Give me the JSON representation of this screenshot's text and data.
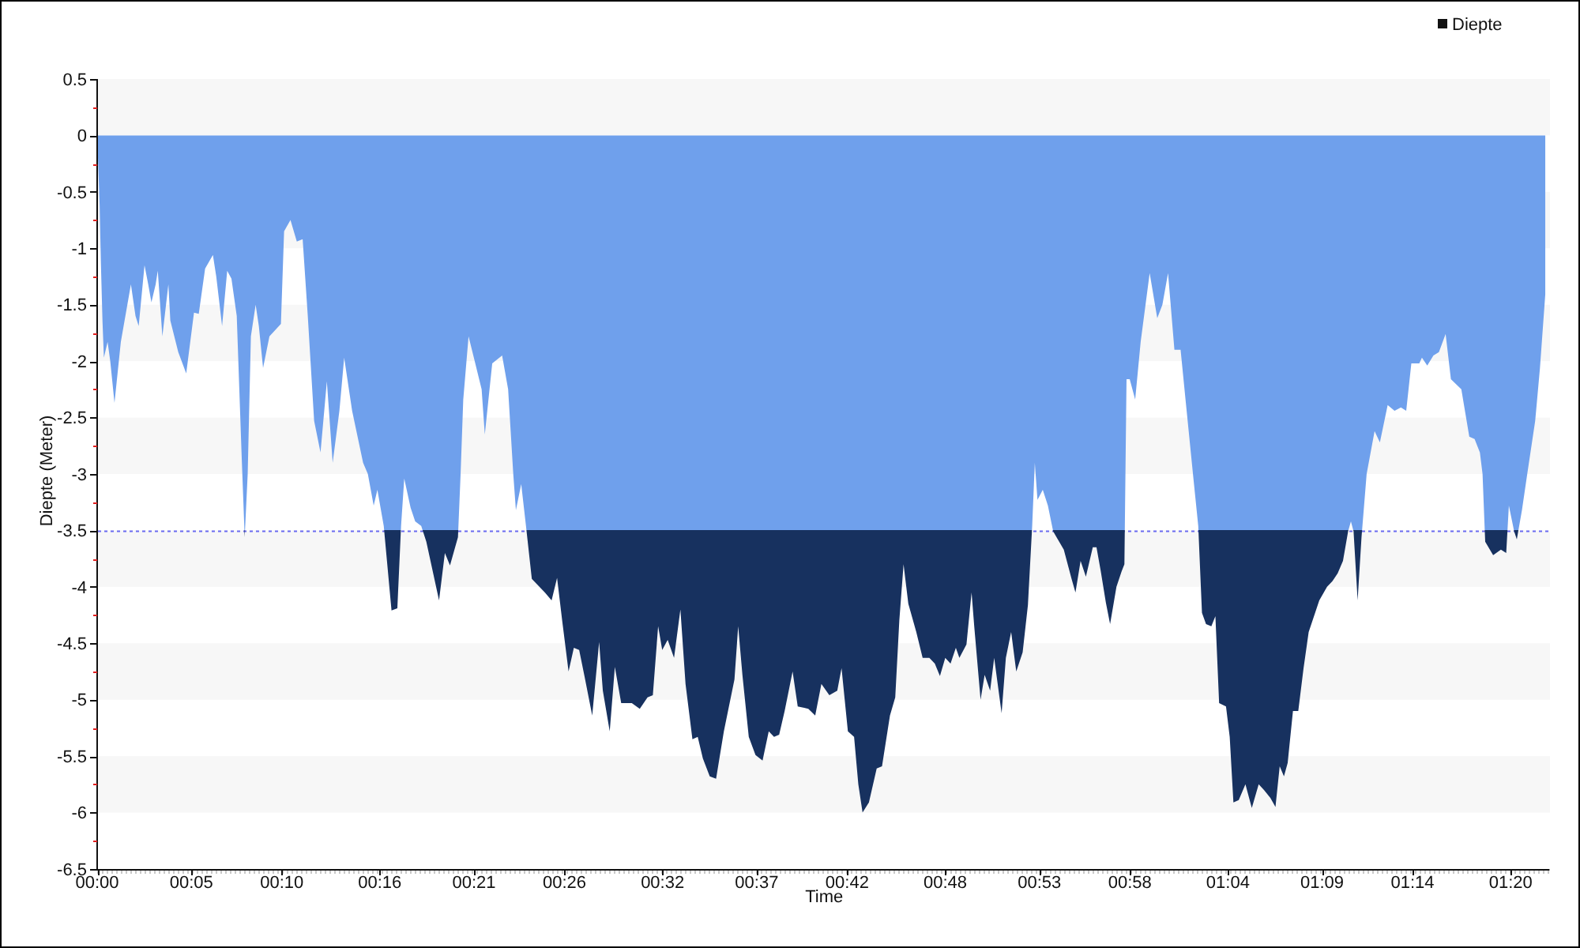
{
  "chart_data": {
    "type": "area",
    "xlabel": "Time",
    "ylabel": "Diepte (Meter)",
    "x": [
      0,
      0.14,
      0.21,
      0.3,
      0.38,
      0.59,
      0.74,
      0.98,
      1.34,
      1.91,
      2.17,
      2.35,
      2.68,
      2.89,
      3.07,
      3.31,
      3.43,
      3.69,
      4.03,
      4.14,
      4.59,
      5.04,
      5.48,
      5.75,
      6.11,
      6.55,
      6.74,
      7.07,
      7.36,
      7.6,
      7.9,
      8.17,
      8.35,
      8.52,
      8.7,
      8.97,
      9.15,
      9.39,
      9.75,
      10.4,
      10.58,
      10.94,
      11.3,
      11.63,
      11.92,
      12.28,
      12.64,
      13,
      13.33,
      13.71,
      13.98,
      14.43,
      15.05,
      15.32,
      15.65,
      15.86,
      16.22,
      16.66,
      16.99,
      17.2,
      17.38,
      17.74,
      18,
      18.34,
      18.63,
      19.35,
      19.68,
      19.97,
      20.42,
      20.57,
      20.72,
      21.02,
      21.32,
      21.76,
      21.94,
      22.36,
      22.92,
      23.26,
      23.55,
      23.7,
      24,
      24.27,
      24.6,
      25.34,
      25.72,
      26.03,
      26.32,
      26.68,
      26.98,
      27.28,
      27.58,
      28.02,
      28.41,
      28.62,
      29.01,
      29.3,
      29.66,
      30.26,
      30.71,
      31.15,
      31.45,
      31.75,
      31.98,
      32.29,
      32.65,
      33.01,
      33.3,
      33.69,
      33.99,
      34.28,
      34.67,
      35.03,
      35.47,
      36.07,
      36.28,
      36.52,
      36.88,
      37.26,
      37.66,
      38.01,
      38.31,
      38.6,
      38.91,
      39.36,
      39.65,
      40.25,
      40.64,
      40.99,
      41.44,
      41.89,
      42.13,
      42.49,
      42.84,
      43.08,
      43.32,
      43.68,
      44.12,
      44.42,
      44.87,
      45.17,
      45.4,
      45.64,
      45.91,
      46.36,
      46.72,
      47.1,
      47.41,
      47.7,
      48,
      48.3,
      48.6,
      48.8,
      49.2,
      49.49,
      49.64,
      50,
      50.23,
      50.54,
      50.77,
      51.19,
      51.43,
      51.73,
      52.02,
      52.38,
      52.68,
      52.92,
      53.07,
      53.22,
      53.52,
      53.81,
      54.11,
      54.71,
      55.15,
      55.37,
      55.66,
      55.96,
      56.35,
      56.56,
      56.8,
      57.09,
      57.33,
      57.69,
      57.99,
      58.14,
      58.26,
      58.44,
      58.75,
      59.06,
      59.57,
      60,
      60.29,
      60.61,
      60.97,
      61.32,
      61.72,
      62.02,
      62.32,
      62.53,
      62.76,
      63.06,
      63.29,
      63.5,
      63.89,
      64.1,
      64.31,
      64.61,
      64.99,
      65.35,
      65.74,
      66.04,
      66.4,
      66.69,
      66.93,
      67.17,
      67.38,
      67.68,
      67.98,
      68.28,
      68.57,
      68.87,
      69.17,
      69.61,
      69.91,
      70.21,
      70.51,
      70.8,
      70.96,
      71.11,
      71.34,
      71.56,
      71.85,
      72.3,
      72.6,
      73.04,
      73.43,
      73.79,
      74.09,
      74.38,
      74.83,
      74.98,
      75.28,
      75.63,
      75.94,
      76.32,
      76.62,
      77.21,
      77.66,
      77.96,
      78.26,
      78.41,
      78.56,
      79.01,
      79.45,
      79.75,
      79.9,
      80.2,
      80.35,
      80.64,
      80.94,
      81.39,
      81.66,
      81.96
    ],
    "series": [
      {
        "name": "Diepte",
        "color": "#6fa0ec",
        "values": [
          0,
          -0.62,
          -1.13,
          -1.64,
          -1.97,
          -1.83,
          -2,
          -2.37,
          -1.83,
          -1.32,
          -1.6,
          -1.69,
          -1.15,
          -1.32,
          -1.48,
          -1.32,
          -1.2,
          -1.78,
          -1.32,
          -1.64,
          -1.92,
          -2.11,
          -1.57,
          -1.58,
          -1.18,
          -1.06,
          -1.25,
          -1.69,
          -1.2,
          -1.27,
          -1.6,
          -2.81,
          -3.56,
          -3,
          -1.78,
          -1.5,
          -1.69,
          -2.06,
          -1.78,
          -1.67,
          -0.85,
          -0.75,
          -0.94,
          -0.92,
          -1.6,
          -2.53,
          -2.81,
          -2.18,
          -2.9,
          -2.44,
          -1.97,
          -2.44,
          -2.9,
          -3,
          -3.28,
          -3.14,
          -3.46,
          -4.21,
          -4.19,
          -3.46,
          -3.04,
          -3.3,
          -3.42,
          -3.46,
          -3.6,
          -4.12,
          -3.7,
          -3.81,
          -3.56,
          -3,
          -2.34,
          -1.78,
          -1.97,
          -2.25,
          -2.65,
          -2.02,
          -1.95,
          -2.25,
          -3,
          -3.32,
          -3.09,
          -3.46,
          -3.93,
          -4.05,
          -4.12,
          -3.92,
          -4.3,
          -4.75,
          -4.54,
          -4.56,
          -4.79,
          -5.14,
          -4.49,
          -4.92,
          -5.28,
          -4.71,
          -5.03,
          -5.03,
          -5.08,
          -4.98,
          -4.96,
          -4.35,
          -4.56,
          -4.47,
          -4.63,
          -4.2,
          -4.86,
          -5.35,
          -5.33,
          -5.52,
          -5.68,
          -5.7,
          -5.28,
          -4.82,
          -4.35,
          -4.78,
          -5.33,
          -5.49,
          -5.54,
          -5.28,
          -5.33,
          -5.31,
          -5.1,
          -4.75,
          -5.06,
          -5.08,
          -5.14,
          -4.86,
          -4.96,
          -4.92,
          -4.72,
          -5.28,
          -5.33,
          -5.75,
          -6,
          -5.91,
          -5.61,
          -5.59,
          -5.14,
          -4.98,
          -4.3,
          -3.8,
          -4.15,
          -4.4,
          -4.63,
          -4.63,
          -4.68,
          -4.79,
          -4.63,
          -4.68,
          -4.54,
          -4.63,
          -4.51,
          -4.05,
          -4.35,
          -5,
          -4.78,
          -4.92,
          -4.63,
          -5.12,
          -4.63,
          -4.4,
          -4.75,
          -4.58,
          -4.16,
          -3.46,
          -2.9,
          -3.23,
          -3.14,
          -3.28,
          -3.51,
          -3.67,
          -3.93,
          -4.05,
          -3.77,
          -3.91,
          -3.65,
          -3.65,
          -3.86,
          -4.14,
          -4.33,
          -4,
          -3.86,
          -3.8,
          -2.16,
          -2.16,
          -2.34,
          -1.83,
          -1.22,
          -1.62,
          -1.5,
          -1.22,
          -1.9,
          -1.9,
          -2.53,
          -3,
          -3.46,
          -4.23,
          -4.33,
          -4.35,
          -4.26,
          -5.03,
          -5.06,
          -5.33,
          -5.91,
          -5.89,
          -5.75,
          -5.96,
          -5.75,
          -5.8,
          -5.87,
          -5.95,
          -5.59,
          -5.68,
          -5.56,
          -5.1,
          -5.1,
          -4.72,
          -4.4,
          -4.26,
          -4.12,
          -4,
          -3.95,
          -3.88,
          -3.77,
          -3.51,
          -3.42,
          -3.51,
          -4.12,
          -3.56,
          -3,
          -2.62,
          -2.72,
          -2.39,
          -2.44,
          -2.41,
          -2.44,
          -2.02,
          -2.02,
          -1.97,
          -2.04,
          -1.95,
          -1.92,
          -1.76,
          -2.16,
          -2.25,
          -2.67,
          -2.69,
          -2.81,
          -3,
          -3.6,
          -3.72,
          -3.67,
          -3.7,
          -3.28,
          -3.51,
          -3.58,
          -3.32,
          -3,
          -2.53,
          -2.06,
          -1.41
        ]
      }
    ],
    "xlim": [
      0,
      82.2
    ],
    "ylim": [
      -6.5,
      0.5
    ],
    "xticks": [
      {
        "value": 0,
        "label": "00:00"
      },
      {
        "value": 5.33,
        "label": "00:05"
      },
      {
        "value": 10.45,
        "label": "00:10"
      },
      {
        "value": 16,
        "label": "00:16"
      },
      {
        "value": 21.33,
        "label": "00:21"
      },
      {
        "value": 26.45,
        "label": "00:26"
      },
      {
        "value": 32,
        "label": "00:32"
      },
      {
        "value": 37.33,
        "label": "00:37"
      },
      {
        "value": 42.45,
        "label": "00:42"
      },
      {
        "value": 48,
        "label": "00:48"
      },
      {
        "value": 53.33,
        "label": "00:53"
      },
      {
        "value": 58.45,
        "label": "00:58"
      },
      {
        "value": 64,
        "label": "01:04"
      },
      {
        "value": 69.33,
        "label": "01:09"
      },
      {
        "value": 74.45,
        "label": "01:14"
      },
      {
        "value": 80,
        "label": "01:20"
      }
    ],
    "yticks": [
      0.5,
      0,
      -0.5,
      -1,
      -1.5,
      -2,
      -2.5,
      -3,
      -3.5,
      -4,
      -4.5,
      -5,
      -5.5,
      -6,
      -6.5
    ],
    "ref_lines": [
      {
        "axis": "y",
        "value": -3.5,
        "color": "#6b6bf0"
      }
    ]
  }
}
